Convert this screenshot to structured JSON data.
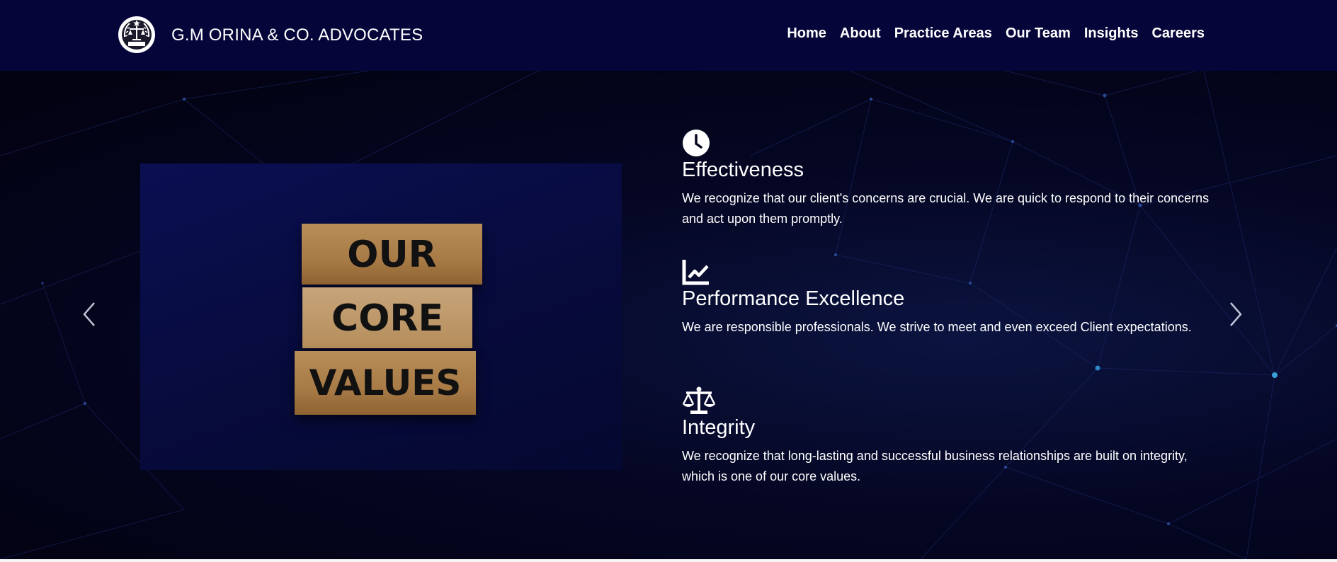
{
  "header": {
    "brand": "G.M ORINA & CO. ADVOCATES",
    "nav": [
      "Home",
      "About",
      "Practice Areas",
      "Our Team",
      "Insights",
      "Careers"
    ]
  },
  "photo": {
    "words": [
      "OUR",
      "CORE",
      "VALUES"
    ]
  },
  "values": [
    {
      "icon": "clock-icon",
      "title": "Effectiveness",
      "text": "We recognize that our client's concerns are crucial. We are quick to respond to their concerns and act upon them promptly."
    },
    {
      "icon": "line-chart-icon",
      "title": "Performance Excellence",
      "text": "We are responsible professionals. We strive to meet and even exceed Client expectations."
    },
    {
      "icon": "scales-icon",
      "title": "Integrity",
      "text": "We recognize that long-lasting and successful business relationships are built on integrity, which is one of our core values."
    }
  ],
  "colors": {
    "header_bg": "#05053a",
    "page_bg": "#04041a",
    "text": "#ffffff"
  }
}
